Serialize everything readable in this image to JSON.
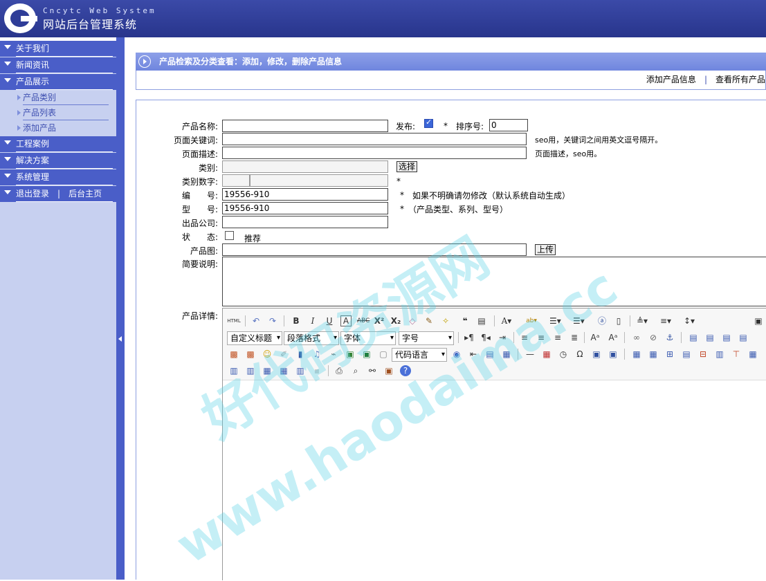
{
  "header": {
    "brand_en": "Cncytc Web System",
    "brand_cn": "网站后台管理系统"
  },
  "sidebar": {
    "items": [
      {
        "label": "关于我们"
      },
      {
        "label": "新闻资讯"
      },
      {
        "label": "产品展示",
        "children": [
          "产品类别",
          "产品列表",
          "添加产品"
        ]
      },
      {
        "label": "工程案例"
      },
      {
        "label": "解决方案"
      },
      {
        "label": "系统管理"
      }
    ],
    "logout": "退出登录",
    "divider": "|",
    "home": "后台主页"
  },
  "main": {
    "title": "产品检索及分类查看：添加，修改，删除产品信息",
    "links": {
      "add": "添加产品信息",
      "divider": "|",
      "view": "查看所有产品"
    }
  },
  "form": {
    "name_label": "产品名称:",
    "publish_label": "发布:",
    "publish_checked": true,
    "star": "*",
    "sort_label": "排序号:",
    "sort_value": "0",
    "keywords_label": "页面关键词:",
    "keywords_note": "seo用，关键词之间用英文逗号隔开。",
    "desc_label": "页面描述:",
    "desc_note": "页面描述，seo用。",
    "category_label": "类别:",
    "choose_button": "选择",
    "category_num_label": "类别数字:",
    "code_label": "编　　号:",
    "code_value": "19556-910",
    "code_note": "如果不明确请勿修改（默认系统自动生成）",
    "model_label": "型　　号:",
    "model_value": "19556-910",
    "model_note": "（产品类型、系列、型号）",
    "company_label": "出品公司:",
    "status_label": "状　　态:",
    "recommend_label": "推荐",
    "image_label": "产品图:",
    "upload_button": "上传",
    "summary_label": "简要说明:",
    "detail_label": "产品详情:"
  },
  "editor": {
    "html_label": "HTML",
    "custom_heading": "自定义标题",
    "paragraph": "段落格式",
    "font_family": "字体",
    "font_size": "字号",
    "code_lang": "代码语言"
  },
  "watermark": {
    "cn": "好代码资源网",
    "url": "www.haodaima.cc"
  }
}
